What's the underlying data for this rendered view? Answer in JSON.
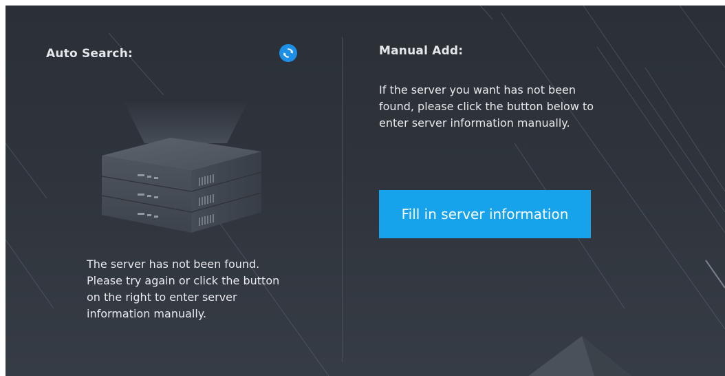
{
  "auto_search": {
    "title": "Auto Search:",
    "refresh_icon": "refresh-icon",
    "server_icon": "server-stack-icon",
    "message": "The server has not been found. Please try again or click the button on the right to enter server information manually."
  },
  "manual_add": {
    "title": "Manual Add:",
    "message": "If the server you want has not been found, please click the button below to enter server information manually.",
    "button_label": "Fill in server information"
  },
  "colors": {
    "background": "#2f343c",
    "accent": "#16a3ec",
    "refresh": "#1e8fe6",
    "text": "#e8eaed"
  }
}
